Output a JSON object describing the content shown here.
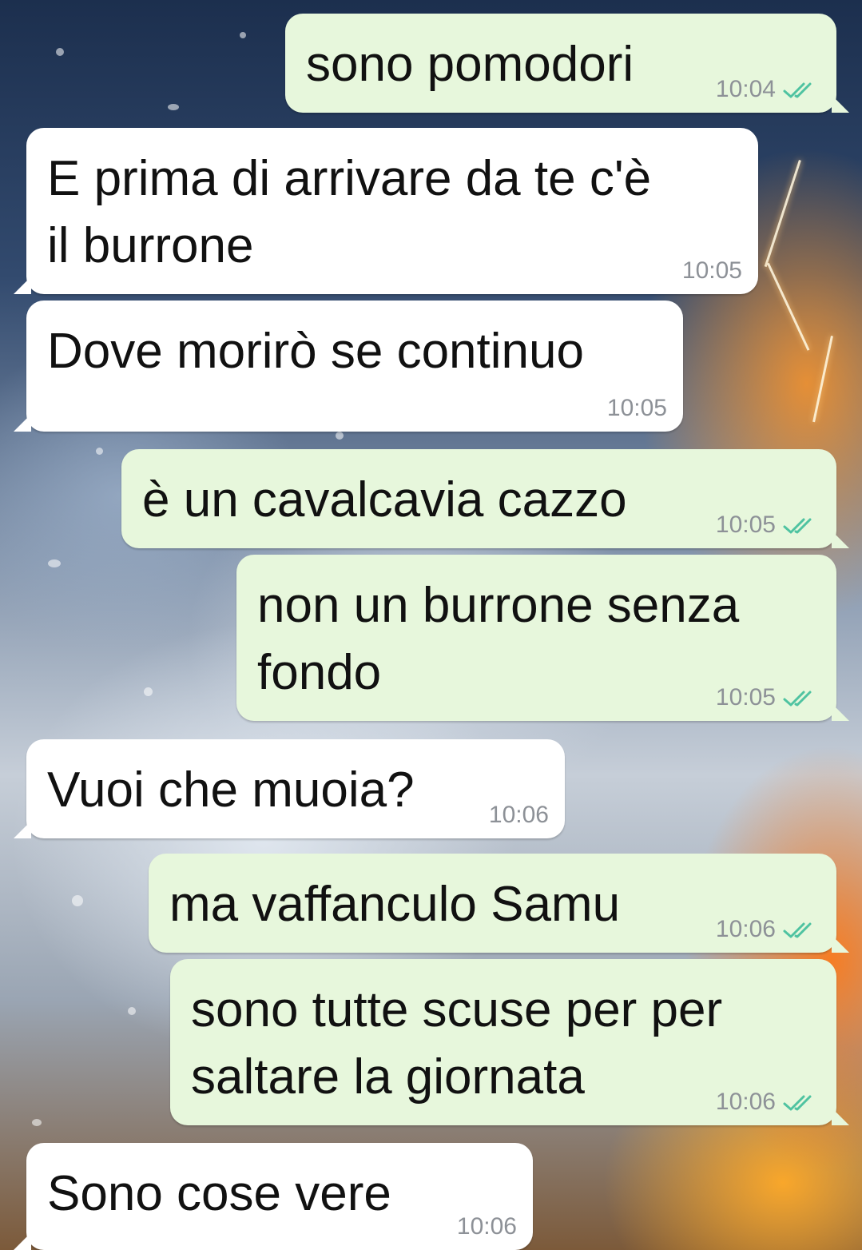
{
  "chat": {
    "messages": [
      {
        "direction": "outgoing",
        "lines": [
          "sono pomodori"
        ],
        "time": "10:04",
        "status": "read-double-check"
      },
      {
        "direction": "incoming",
        "lines": [
          "E prima di arrivare da te c'è",
          "il burrone"
        ],
        "time": "10:05"
      },
      {
        "direction": "incoming",
        "lines": [
          "Dove morirò se continuo"
        ],
        "time": "10:05"
      },
      {
        "direction": "outgoing",
        "lines": [
          "è un cavalcavia cazzo"
        ],
        "time": "10:05",
        "status": "read-double-check"
      },
      {
        "direction": "outgoing",
        "lines": [
          "non un burrone senza",
          "fondo"
        ],
        "time": "10:05",
        "status": "read-double-check"
      },
      {
        "direction": "incoming",
        "lines": [
          "Vuoi che muoia?"
        ],
        "time": "10:06"
      },
      {
        "direction": "outgoing",
        "lines": [
          "ma vaffanculo Samu"
        ],
        "time": "10:06",
        "status": "read-double-check"
      },
      {
        "direction": "outgoing",
        "lines": [
          "sono tutte scuse per per",
          "saltare la giornata"
        ],
        "time": "10:06",
        "status": "read-double-check"
      },
      {
        "direction": "incoming",
        "lines": [
          "Sono cose vere"
        ],
        "time": "10:06"
      }
    ]
  },
  "colors": {
    "incoming_bubble": "#ffffff",
    "outgoing_bubble": "#e7f7dc",
    "message_text": "#111111",
    "timestamp": "#8d9197",
    "read_ticks": "#4fc3a1"
  },
  "icons": {
    "read_status": "double-check-icon"
  }
}
